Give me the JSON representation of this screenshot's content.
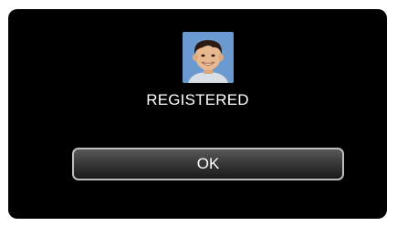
{
  "dialog": {
    "thumbnail_icon": "face-photo-icon",
    "status": "REGISTERED",
    "ok_label": "OK"
  },
  "colors": {
    "screen_background": "#000000",
    "text": "#ffffff",
    "button_border": "#bdbdbd"
  }
}
